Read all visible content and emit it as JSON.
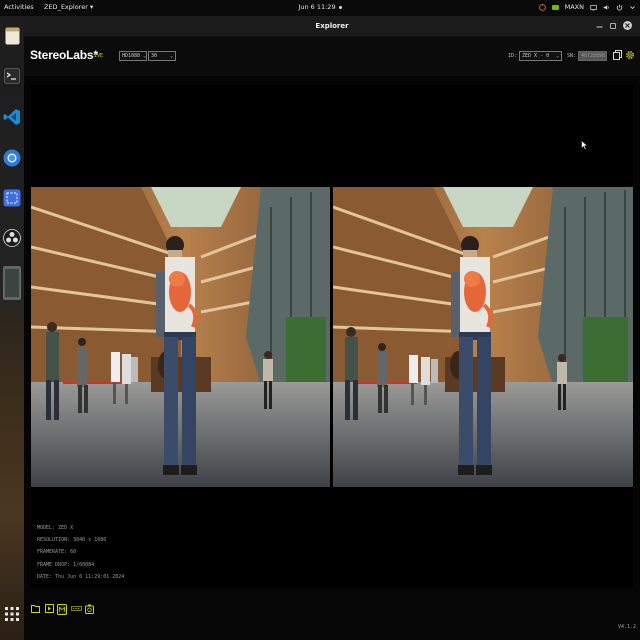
{
  "topbar": {
    "activities": "Activities",
    "app_menu": "ZED_Explorer ▾",
    "clock": "Jun 6  11:29",
    "power_mode": "MAXN",
    "icons": [
      "ubuntu-logo-icon",
      "nvidia-icon",
      "network-icon",
      "volume-icon",
      "power-icon",
      "chevron-down-icon"
    ]
  },
  "dock": {
    "items": [
      "files-icon",
      "terminal-icon",
      "vscode-icon",
      "chromium-icon",
      "screenshot-icon",
      "obs-icon",
      "window-thumbnail",
      "show-apps-icon"
    ]
  },
  "window": {
    "title": "Explorer"
  },
  "toolbar": {
    "brand": "StereoLabs*",
    "live": "LIVE",
    "resolution": "HD1080",
    "fps": "30",
    "id_label": "ID:",
    "id_value": "ZED X - 0",
    "sn_label": "SN:",
    "sn_value": "40728890",
    "icons": [
      "copy-icon",
      "settings-icon"
    ]
  },
  "info": {
    "model": "MODEL: ZED X",
    "resolution": "RESOLUTION: 3840 x 1080",
    "framerate": "FRAMERATE: 60",
    "frame_drop": "FRAME DROP: 1/60084",
    "date": "DATE: Thu Jun 6 11:29:01 2024"
  },
  "bottombar": {
    "icons": [
      "folder-icon",
      "video-icon",
      "rec-mode-icon",
      "rec-label-icon",
      "snapshot-icon"
    ],
    "version": "V4.1.2"
  },
  "colors": {
    "live": "#c9d42b",
    "nvidia": "#76b900",
    "accent": "#c9d42b"
  }
}
